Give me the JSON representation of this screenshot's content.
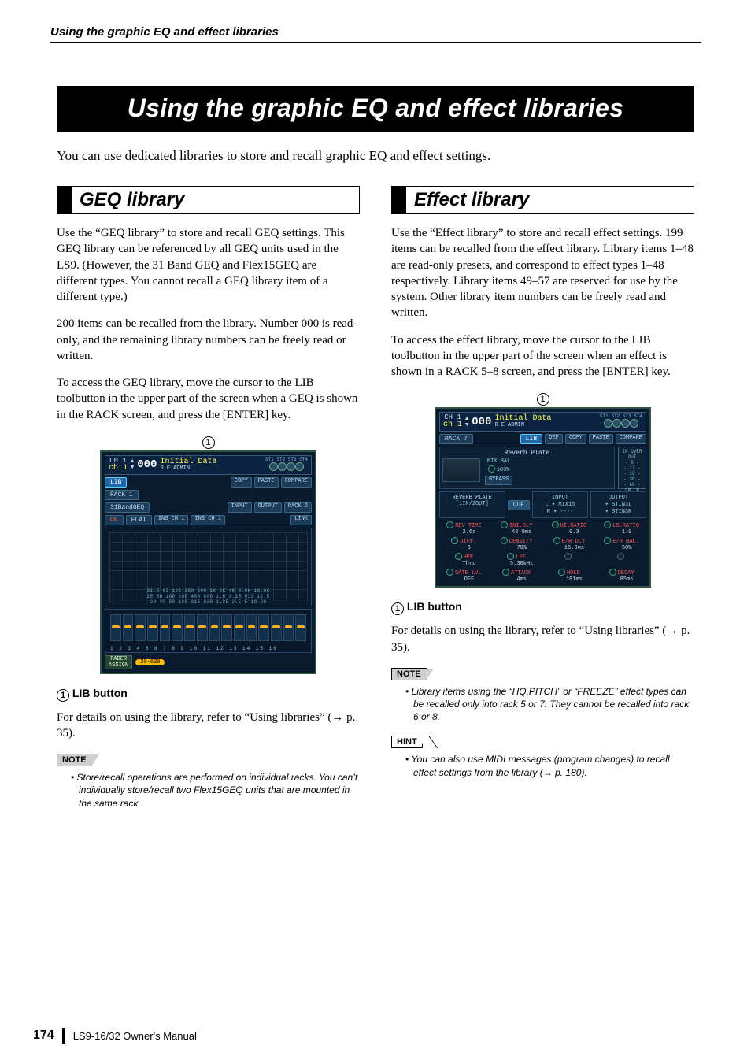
{
  "running_head": "Using the graphic EQ and effect libraries",
  "banner": "Using the graphic EQ and effect libraries",
  "intro": "You can use dedicated libraries to store and recall graphic EQ and effect settings.",
  "footer": {
    "page": "174",
    "manual": "LS9-16/32  Owner's Manual"
  },
  "refs": {
    "p35": "p. 35",
    "p180": "p. 180"
  },
  "callouts": {
    "one": "1"
  },
  "left": {
    "heading": "GEQ library",
    "p1": "Use the “GEQ library” to store and recall GEQ settings. This GEQ library can be referenced by all GEQ units used in the LS9. (However, the 31 Band GEQ and Flex15GEQ are different types. You cannot recall a GEQ library item of a different type.)",
    "p2": "200 items can be recalled from the library. Number 000 is read-only, and the remaining library numbers can be freely read or written.",
    "p3": "To access the GEQ library, move the cursor to the LIB toolbutton in the upper part of the screen when a GEQ is shown in the RACK screen, and press the [ENTER] key.",
    "caption": "LIB button",
    "details_a": "For details on using the library, refer to “Using libraries” (",
    "details_b": ").",
    "note_label": "NOTE",
    "note_bullet": "Store/recall operations are performed on individual racks. You can’t individually store/recall two Flex15GEQ units that are mounted in the same rack.",
    "shot": {
      "ch_a": "CH 1",
      "ch_b": "ch 1",
      "num": "000",
      "re": "R E",
      "init": "Initial Data",
      "admin": "ADMIN",
      "st": [
        "ST1",
        "ST2",
        "ST3",
        "ST4"
      ],
      "lib": "LIB",
      "copy": "COPY",
      "paste": "PASTE",
      "compare": "COMPARE",
      "rack": "RACK 1",
      "type": "31BandGEQ",
      "on": "ON",
      "flat": "FLAT",
      "input": "INPUT",
      "output": "OUTPUT",
      "ins1": "INS CH 1",
      "ins2": "INS CH 1",
      "rack2": "RACK 2",
      "link": "LINK",
      "freqs": "31.5 63 125 250 500 1K 2K 4K 8.0K 16.0K\n25 50 100 200 400 800 1.6 3.15 6.3 12.5\n20 40 80 160 315 630 1.25 2.5 5 10 20",
      "slider_nums": "1 2 3 4 5 6 7 8 9 10 11 12 13 14 15 16",
      "fader_assign": "FADER\nASSIGN",
      "fader_range": "20-630"
    }
  },
  "right": {
    "heading": "Effect library",
    "p1": "Use the “Effect library” to store and recall effect settings. 199 items can be recalled from the effect library. Library items 1–48 are read-only presets, and correspond to effect types 1–48 respectively. Library items 49–57 are reserved for use by the system. Other library item numbers can be freely read and written.",
    "p2": "To access the effect library, move the cursor to the LIB toolbutton in the upper part of the screen when an effect is shown in a RACK 5–8 screen, and press the [ENTER] key.",
    "caption": "LIB button",
    "details_a": "For details on using the library, refer to “Using libraries” (",
    "details_b": ").",
    "note_label": "NOTE",
    "note_bullet": "Library items using the “HQ.PITCH” or “FREEZE” effect types can be recalled only into rack 5 or 7. They cannot be recalled into rack 6 or 8.",
    "hint_label": "HINT",
    "hint_bullet_a": "You can also use MIDI messages (program changes) to recall effect settings from the library (",
    "hint_bullet_b": ").",
    "shot": {
      "ch_a": "CH 1",
      "ch_b": "ch 1",
      "num": "000",
      "re": "R E",
      "init": "Initial Data",
      "admin": "ADMIN",
      "st": [
        "ST1",
        "ST2",
        "ST3",
        "ST4"
      ],
      "rack": "RACK 7",
      "lib": "LIB",
      "def": "DEF",
      "copy": "COPY",
      "paste": "PASTE",
      "compare": "COMPARE",
      "fx_title": "Reverb Plate",
      "mixbal": "MIX BAL",
      "mixbal_v": "100%",
      "bypass": "BYPASS",
      "meter": "IN  OVER  OUT\n- 6 -\n- 12 -\n- 18 -\n- 30 -\n- 60 -\nLR     LR",
      "type": "REVERB PLATE",
      "io": "[1IN/2OUT]",
      "cue": "CUE",
      "input": "INPUT",
      "output": "OUTPUT",
      "l": "L",
      "r": "R",
      "mix15": "MIX15",
      "stin3l": "STIN3L",
      "stin3r": "STIN3R",
      "params": [
        {
          "n": "REV TIME",
          "v": "2.6s"
        },
        {
          "n": "INI.DLY",
          "v": "42.0ms"
        },
        {
          "n": "HI.RATIO",
          "v": "0.3"
        },
        {
          "n": "LO.RATIO",
          "v": "1.0"
        },
        {
          "n": "DIFF.",
          "v": "6"
        },
        {
          "n": "DENSITY",
          "v": "70%"
        },
        {
          "n": "E/R DLY",
          "v": "16.0ms"
        },
        {
          "n": "E/R BAL.",
          "v": "50%"
        },
        {
          "n": "HPF",
          "v": "Thru"
        },
        {
          "n": "LPF",
          "v": "5.30kHz"
        },
        {
          "n": "",
          "v": ""
        },
        {
          "n": "",
          "v": ""
        },
        {
          "n": "GATE LVL",
          "v": "OFF"
        },
        {
          "n": "ATTACK",
          "v": "4ms"
        },
        {
          "n": "HOLD",
          "v": "181ms"
        },
        {
          "n": "DECAY",
          "v": "85ms"
        }
      ]
    }
  }
}
